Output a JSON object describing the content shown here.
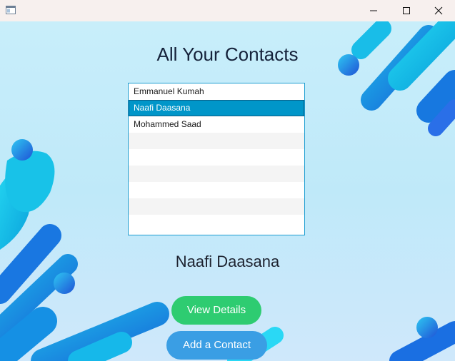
{
  "window": {
    "icon": "app-window-icon",
    "controls": {
      "minimize_icon": "minimize-icon",
      "maximize_icon": "maximize-icon",
      "close_icon": "close-icon"
    }
  },
  "page": {
    "title": "All Your Contacts",
    "selected_contact_name": "Naafi Daasana"
  },
  "contacts": {
    "items": [
      "Emmanuel Kumah",
      "Naafi Daasana",
      "Mohammed Saad"
    ],
    "selected_index": 1
  },
  "buttons": {
    "view_details": "View Details",
    "add_contact": "Add a Contact"
  },
  "colors": {
    "selection": "#0096c9",
    "view_details": "#2ecc71",
    "add_contact": "#3a9ee4"
  }
}
